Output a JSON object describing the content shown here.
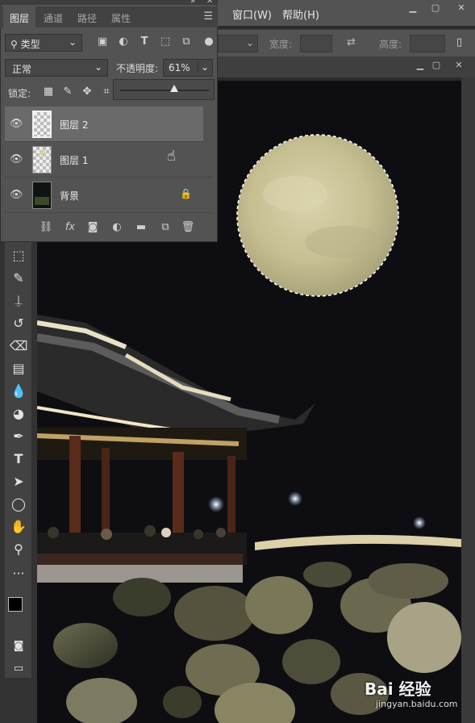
{
  "menubar": {
    "items": [
      "窗口(W)",
      "帮助(H)"
    ]
  },
  "optionsbar": {
    "width_label": "宽度:",
    "height_label": "高度:"
  },
  "panel": {
    "tabs": [
      "图层",
      "通道",
      "路径",
      "属性"
    ],
    "filter": {
      "kind_label": "类型"
    },
    "blend_mode": "正常",
    "opacity_label": "不透明度:",
    "opacity_value": "61%",
    "opacity_level": 0.61,
    "lock_label": "锁定:",
    "layers": [
      {
        "name": "图层 2",
        "selected": true,
        "visible": true,
        "locked": false
      },
      {
        "name": "图层 1",
        "selected": false,
        "visible": true,
        "locked": false
      },
      {
        "name": "背景",
        "selected": false,
        "visible": true,
        "locked": true
      }
    ],
    "footer_icons": [
      "link-icon",
      "fx-icon",
      "mask-icon",
      "adjustment-icon",
      "folder-icon",
      "new-layer-icon",
      "trash-icon"
    ]
  },
  "toolbar": {
    "tools": [
      "marquee-icon",
      "brush-icon",
      "stamp-icon",
      "history-brush-icon",
      "eraser-icon",
      "gradient-icon",
      "blur-icon",
      "dodge-icon",
      "pen-icon",
      "type-icon",
      "path-select-icon",
      "ellipse-icon",
      "hand-icon",
      "zoom-icon",
      "more-icon"
    ]
  },
  "watermark": {
    "brand": "Bai 经验",
    "url": "jingyan.baidu.com"
  },
  "colors": {
    "panel": "#535353",
    "selected_layer": "#6a6a6a",
    "canvas": "#0d0d10",
    "moon": "#cfc9a0"
  }
}
